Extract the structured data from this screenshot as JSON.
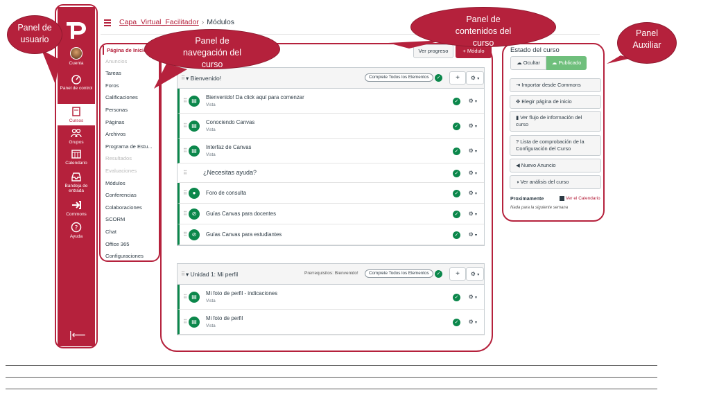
{
  "global_nav": {
    "items": [
      {
        "label": "Cuenta",
        "icon": "avatar"
      },
      {
        "label": "Panel de control",
        "icon": "dashboard-icon"
      },
      {
        "label": "Cursos",
        "icon": "book-icon"
      },
      {
        "label": "Grupos",
        "icon": "groups-icon"
      },
      {
        "label": "Calendario",
        "icon": "calendar-icon"
      },
      {
        "label": "Bandeja de entrada",
        "icon": "inbox-icon"
      },
      {
        "label": "Commons",
        "icon": "commons-icon"
      },
      {
        "label": "Ayuda",
        "icon": "help-icon"
      }
    ],
    "collapse_glyph": "|⟵"
  },
  "breadcrumb": {
    "course": "Capa_Virtual_Facilitador",
    "separator": "›",
    "current": "Módulos"
  },
  "course_nav": {
    "items": [
      {
        "label": "Página de Inicio",
        "state": "active"
      },
      {
        "label": "Anuncios",
        "state": "dim"
      },
      {
        "label": "Tareas",
        "state": "normal"
      },
      {
        "label": "Foros",
        "state": "normal"
      },
      {
        "label": "Calificaciones",
        "state": "normal"
      },
      {
        "label": "Personas",
        "state": "normal"
      },
      {
        "label": "Páginas",
        "state": "normal"
      },
      {
        "label": "Archivos",
        "state": "normal"
      },
      {
        "label": "Programa de Estu...",
        "state": "normal"
      },
      {
        "label": "Resultados",
        "state": "dim"
      },
      {
        "label": "Evaluaciones",
        "state": "dim"
      },
      {
        "label": "Módulos",
        "state": "normal"
      },
      {
        "label": "Conferencias",
        "state": "normal"
      },
      {
        "label": "Colaboraciones",
        "state": "normal"
      },
      {
        "label": "SCORM",
        "state": "normal"
      },
      {
        "label": "Chat",
        "state": "normal"
      },
      {
        "label": "Office 365",
        "state": "normal"
      },
      {
        "label": "Configuraciones",
        "state": "normal"
      }
    ]
  },
  "toolbar": {
    "progress_label": "Ver progreso",
    "add_module_label": "+ Módulo"
  },
  "modules": [
    {
      "title": "Bienvenido!",
      "prereq": "",
      "complete_all": "Complete Todos los Elementos",
      "items": [
        {
          "title": "Bienvenido! Da click aquí para comenzar",
          "sub": "Vista",
          "icon": "page-icon",
          "glyph": "▤",
          "type": "item"
        },
        {
          "title": "Conociendo Canvas",
          "sub": "Vista",
          "icon": "page-icon",
          "glyph": "▤",
          "type": "item"
        },
        {
          "title": "Interfaz de Canvas",
          "sub": "Vista",
          "icon": "page-icon",
          "glyph": "▤",
          "type": "item"
        },
        {
          "title": "¿Necesitas ayuda?",
          "sub": "",
          "icon": "",
          "glyph": "",
          "type": "subheader"
        },
        {
          "title": "Foro de consulta",
          "sub": "",
          "icon": "discussion-icon",
          "glyph": "●",
          "type": "item"
        },
        {
          "title": "Guías Canvas para docentes",
          "sub": "",
          "icon": "link-icon",
          "glyph": "⊘",
          "type": "item"
        },
        {
          "title": "Guías Canvas para estudiantes",
          "sub": "",
          "icon": "link-icon",
          "glyph": "⊘",
          "type": "item"
        }
      ]
    },
    {
      "title": "Unidad 1: Mi perfil",
      "prereq": "Prerrequisitos: Bienvenido!",
      "complete_all": "Complete Todos los Elementos",
      "items": [
        {
          "title": "Mi foto de perfil - indicaciones",
          "sub": "Vista",
          "icon": "page-icon",
          "glyph": "▤",
          "type": "item"
        },
        {
          "title": "Mi foto de perfil",
          "sub": "Vista",
          "icon": "page-icon",
          "glyph": "▤",
          "type": "item"
        }
      ]
    }
  ],
  "aux": {
    "title": "Estado del curso",
    "ocultar": "Ocultar",
    "publicado": "Publicado",
    "buttons": [
      {
        "label": "Importar desde Commons",
        "glyph": "⇥",
        "icon": "import-icon"
      },
      {
        "label": "Elegir página de inicio",
        "glyph": "✥",
        "icon": "home-page-icon"
      },
      {
        "label": "Ver flujo de información del curso",
        "glyph": "▮",
        "icon": "stream-icon"
      },
      {
        "label": "Lista de comprobación de la Configuración del Curso",
        "glyph": "?",
        "icon": "checklist-icon"
      },
      {
        "label": "Nuevo Anuncio",
        "glyph": "◀",
        "icon": "announcement-icon"
      },
      {
        "label": "Ver análisis del curso",
        "glyph": "◑",
        "icon": "analytics-icon"
      }
    ],
    "upcoming_title": "Proximamente",
    "calendar_link": "Ver el Calendario",
    "upcoming_empty": "Nada para la siguiente semana"
  },
  "callouts": {
    "user_panel": "Panel de usuario",
    "nav_panel": "Panel de navegación del curso",
    "content_panel": "Panel de contenidos del curso",
    "aux_panel": "Panel Auxiliar"
  },
  "colors": {
    "brand": "#b5213c",
    "published": "#0b874b"
  }
}
